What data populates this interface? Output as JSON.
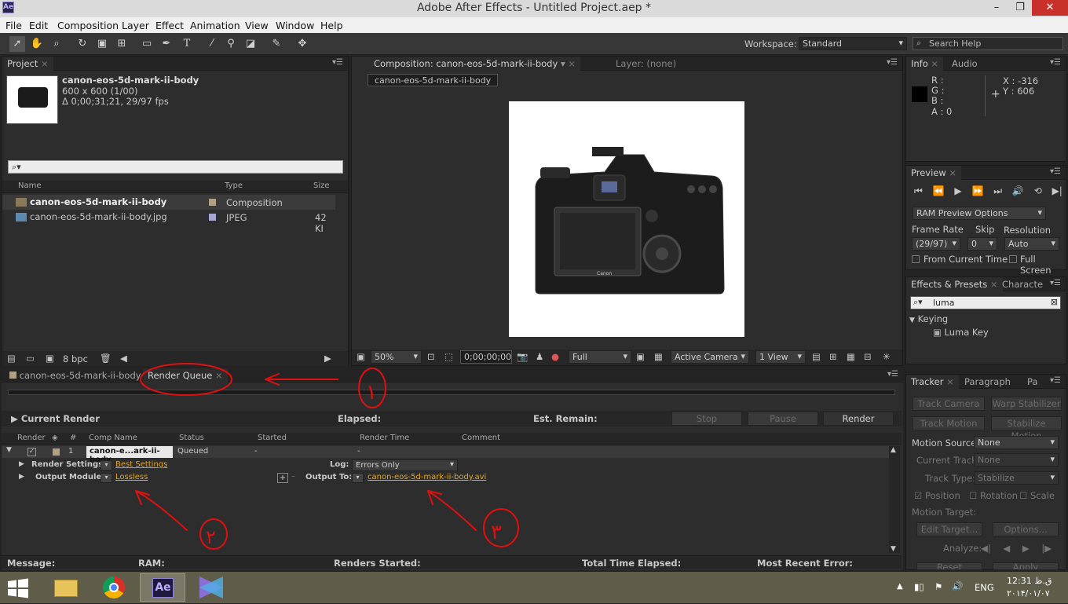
{
  "window": {
    "title": "Adobe After Effects - Untitled Project.aep *",
    "app_badge": "Ae",
    "min": "–",
    "max": "❐",
    "close": "✕"
  },
  "menu": [
    "File",
    "Edit",
    "Composition",
    "Layer",
    "Effect",
    "Animation",
    "View",
    "Window",
    "Help"
  ],
  "toolbar": {
    "workspace_label": "Workspace:",
    "workspace_value": "Standard",
    "search_placeholder": "Search Help"
  },
  "project": {
    "tab": "Project",
    "item_name": "canon-eos-5d-mark-ii-body",
    "item_dims": "600 x 600 (1/00)",
    "item_duration": "Δ 0;00;31;21, 29/97 fps",
    "columns": {
      "name": "Name",
      "type": "Type",
      "size": "Size"
    },
    "rows": [
      {
        "name": "canon-eos-5d-mark-ii-body",
        "type": "Composition",
        "size": ""
      },
      {
        "name": "canon-eos-5d-mark-ii-body.jpg",
        "type": "JPEG",
        "size": "42 KI"
      }
    ],
    "bpc": "8 bpc"
  },
  "composition": {
    "tab": "Composition: canon-eos-5d-mark-ii-body",
    "layer_tab": "Layer: (none)",
    "breadcrumb": "canon-eos-5d-mark-ii-body",
    "zoom": "50%",
    "timecode": "0;00;00;00",
    "quality": "Full",
    "camera": "Active Camera",
    "views": "1 View",
    "camera_brand": "Canon"
  },
  "info": {
    "tab": "Info",
    "tab2": "Audio",
    "r": "R :",
    "g": "G :",
    "b": "B :",
    "a": "A : 0",
    "x": "X : -316",
    "y": "Y : 606"
  },
  "preview": {
    "tab": "Preview",
    "ram": "RAM Preview Options",
    "frame_rate_label": "Frame Rate",
    "skip_label": "Skip",
    "resolution_label": "Resolution",
    "frame_rate": "(29/97)",
    "skip": "0",
    "resolution": "Auto",
    "from_current": "From Current Time",
    "full_screen": "Full Screen"
  },
  "effects": {
    "tab": "Effects & Presets",
    "tab2": "Characte",
    "search": "luma",
    "category": "Keying",
    "item": "Luma Key"
  },
  "tracker": {
    "tab": "Tracker",
    "tab2": "Paragraph",
    "tab3": "Pa",
    "track_camera": "Track Camera",
    "warp": "Warp Stabilizer",
    "track_motion": "Track Motion",
    "stabilize": "Stabilize Motion",
    "motion_source_label": "Motion Source:",
    "motion_source": "None",
    "current_track_label": "Current Track:",
    "current_track": "None",
    "track_type_label": "Track Type:",
    "track_type": "Stabilize",
    "position": "Position",
    "rotation": "Rotation",
    "scale": "Scale",
    "motion_target": "Motion Target:",
    "edit_target": "Edit Target...",
    "options": "Options...",
    "analyze": "Analyze:",
    "reset": "Reset",
    "apply": "Apply"
  },
  "render": {
    "timeline_tab": "canon-eos-5d-mark-ii-body",
    "tab": "Render Queue",
    "current_render": "Current Render",
    "elapsed": "Elapsed:",
    "est_remain": "Est. Remain:",
    "stop": "Stop",
    "pause": "Pause",
    "render": "Render",
    "columns": {
      "render": "Render",
      "num": "#",
      "comp": "Comp Name",
      "status": "Status",
      "started": "Started",
      "render_time": "Render Time",
      "comment": "Comment"
    },
    "item": {
      "num": "1",
      "comp": "canon-e...ark-ii-body",
      "status": "Queued",
      "started": "-",
      "render_time": "-"
    },
    "render_settings_label": "Render Settings:",
    "render_settings": "Best Settings",
    "log_label": "Log:",
    "log": "Errors Only",
    "output_module_label": "Output Module:",
    "output_module": "Lossless",
    "output_to_label": "Output To:",
    "output_to": "canon-eos-5d-mark-ii-body.avi",
    "status_bar": {
      "message": "Message:",
      "ram": "RAM:",
      "renders_started": "Renders Started:",
      "total_elapsed": "Total Time Elapsed:",
      "recent_error": "Most Recent Error:"
    }
  },
  "annotations": {
    "one": "١",
    "two": "٢",
    "three": "٣"
  },
  "taskbar": {
    "lang": "ENG",
    "time": "12:31 ق.ظ",
    "date": "۲۰۱۴/۰۱/۰۷"
  },
  "colors": {
    "accent_orange": "#e8a41b",
    "annotation_red": "#e01010",
    "panel_bg": "#2d2d2d"
  }
}
